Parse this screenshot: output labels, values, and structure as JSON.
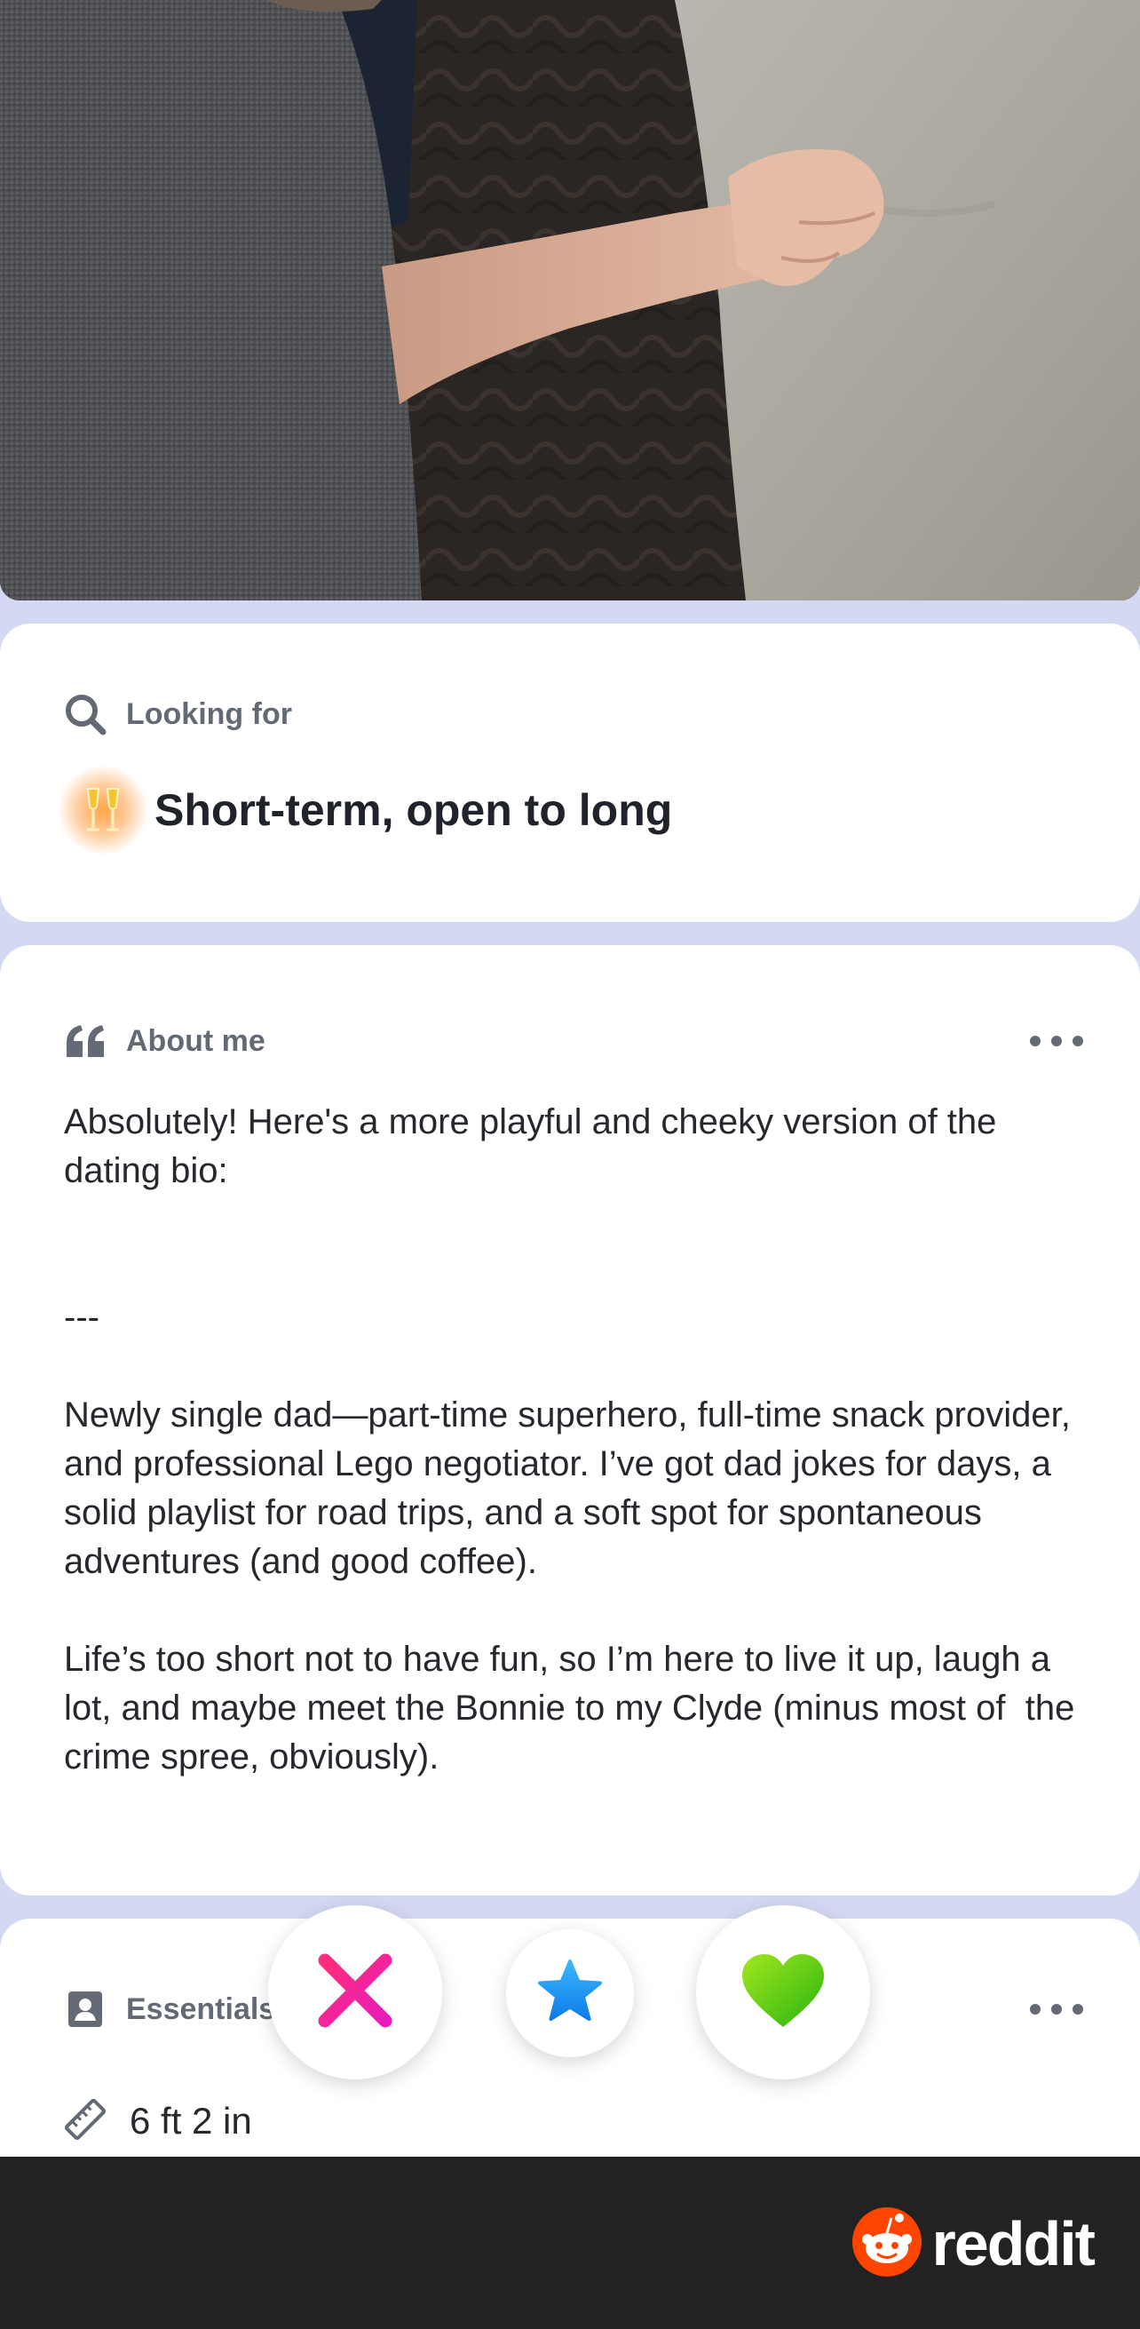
{
  "looking_for": {
    "label": "Looking for",
    "value": "Short-term, open to long",
    "icon": "champagne-icon"
  },
  "about_me": {
    "label": "About me",
    "bio": "Absolutely! Here's a more playful and cheeky version of the dating bio:\n\n\n---\n\nNewly single dad—part-time superhero, full-time snack provider, and professional Lego negotiator. I’ve got dad jokes for days, a solid playlist for road trips, and a soft spot for spontaneous adventures (and good coffee).\n\nLife’s too short not to have fun, so I’m here to live it up, laugh a lot, and maybe meet the Bonnie to my Clyde (minus most of  the crime spree, obviously)."
  },
  "essentials": {
    "label": "Essentials",
    "height": "6 ft 2 in"
  },
  "actions": {
    "nope_icon": "x-icon",
    "super_like_icon": "star-icon",
    "like_icon": "heart-icon"
  },
  "watermark": {
    "brand": "reddit"
  },
  "colors": {
    "background": "#d3d9f2",
    "card": "#ffffff",
    "nope": "#ff1a8c",
    "super_like": "#1e90ff",
    "like": "#4cc712",
    "reddit_orange": "#ff4500",
    "watermark_bar": "#222222"
  }
}
